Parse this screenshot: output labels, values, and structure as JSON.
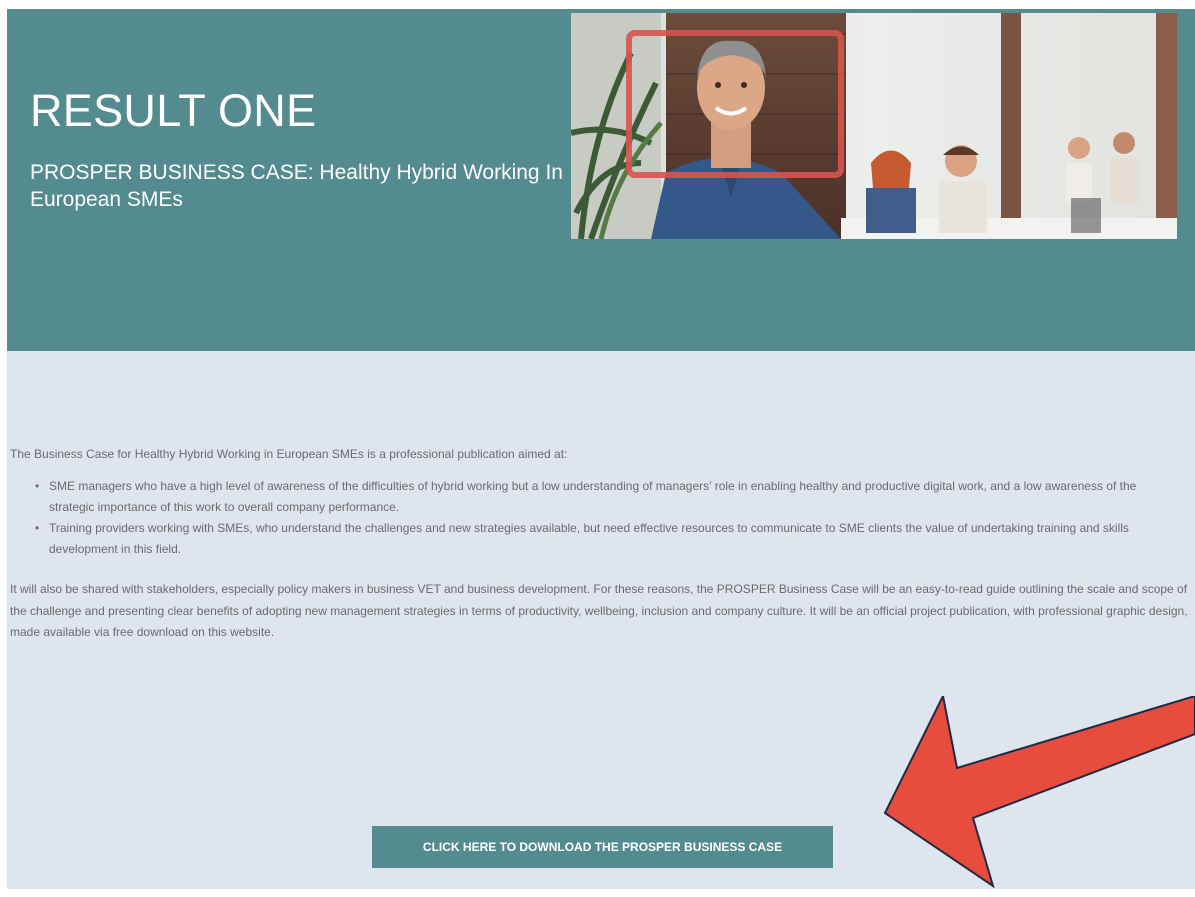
{
  "hero": {
    "title": "RESULT ONE",
    "subtitle": "PROSPER BUSINESS CASE: Healthy Hybrid Working In European SMEs"
  },
  "content": {
    "intro": "The Business Case for Healthy Hybrid Working in European SMEs is a professional publication aimed at:",
    "bullets": [
      "SME managers who have a high level of awareness of the difficulties of hybrid working but a low understanding of managers’ role in enabling healthy and productive digital work, and a low awareness of the strategic importance of this work to overall company performance.",
      "Training providers working with SMEs, who understand the challenges and new strategies available, but need effective resources to communicate to SME clients the value of undertaking training and skills development in this field."
    ],
    "paragraph": "It will also be shared with stakeholders, especially policy makers in business VET and business development. For these reasons, the PROSPER Business Case will be an easy-to-read guide outlining the scale and scope of the challenge and presenting clear benefits of adopting new management strategies in terms of productivity, wellbeing, inclusion and company culture. It will be an official project publication, with professional graphic design, made available via free download on this website."
  },
  "download": {
    "label": "CLICK HERE TO DOWNLOAD THE PROSPER BUSINESS CASE"
  },
  "colors": {
    "hero_bg": "#548b8f",
    "page_bg": "#dfe5ee",
    "button_bg": "#548b8f",
    "arrow": "#e74c3c",
    "highlight_box": "#d9534f"
  }
}
